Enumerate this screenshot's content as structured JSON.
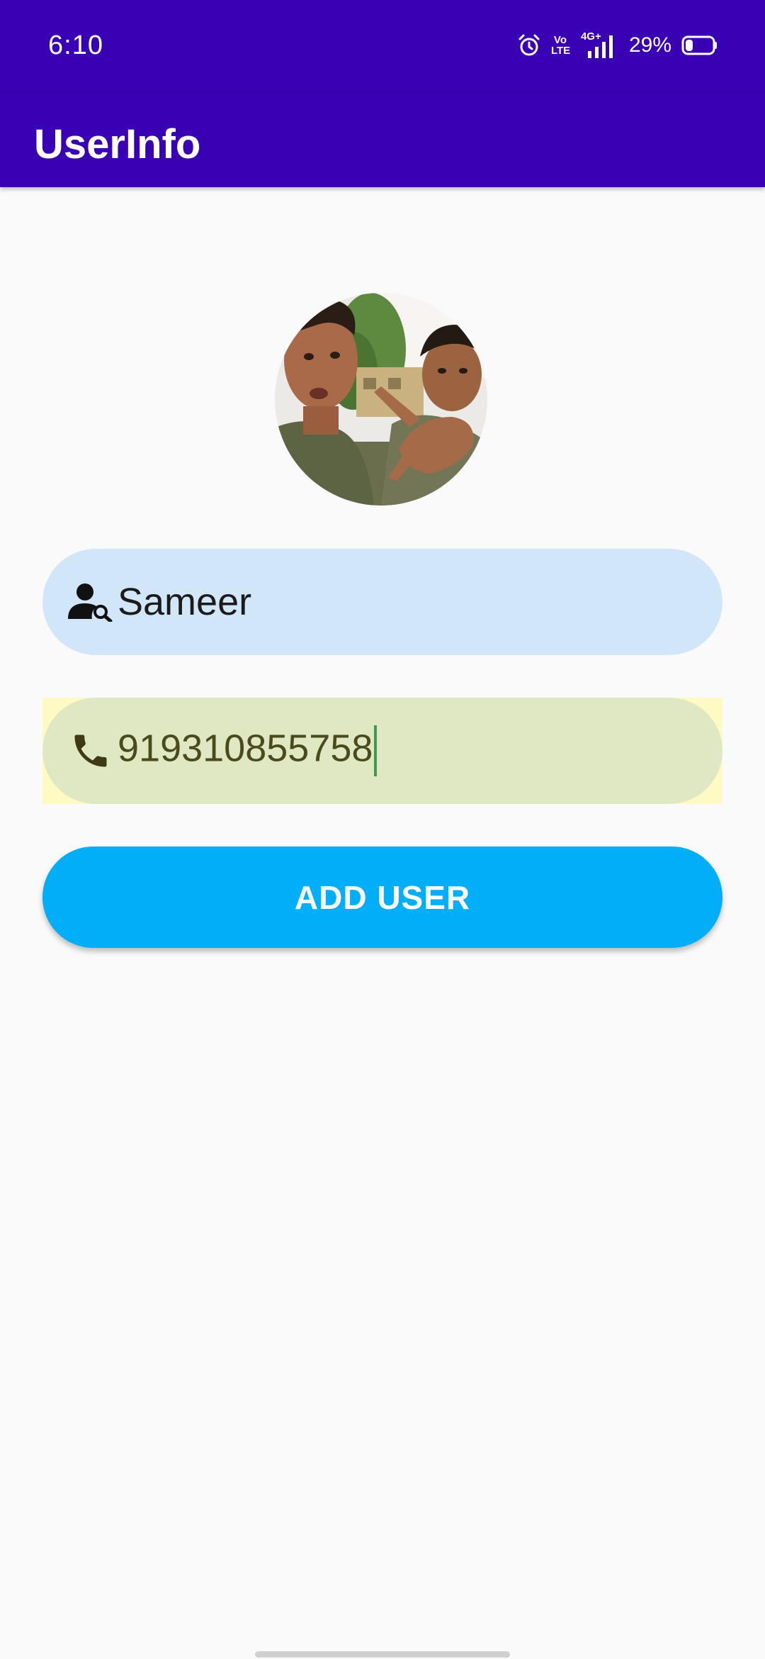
{
  "status_bar": {
    "time": "6:10",
    "icons": [
      "alarm-icon",
      "volte-icon",
      "signal-4g-icon"
    ],
    "volte_text": "Vo LTE",
    "network_text": "4G+",
    "battery_percent": "29%",
    "battery_level": 0.29
  },
  "app_bar": {
    "title": "UserInfo",
    "color": "#3a00b3"
  },
  "avatar": {
    "icon": "profile-photo"
  },
  "form": {
    "name": {
      "icon": "person-search-icon",
      "value": "Sameer"
    },
    "phone": {
      "icon": "phone-icon",
      "value": "919310855758"
    },
    "add_button_label": "ADD USER",
    "button_color": "#03aef8"
  }
}
